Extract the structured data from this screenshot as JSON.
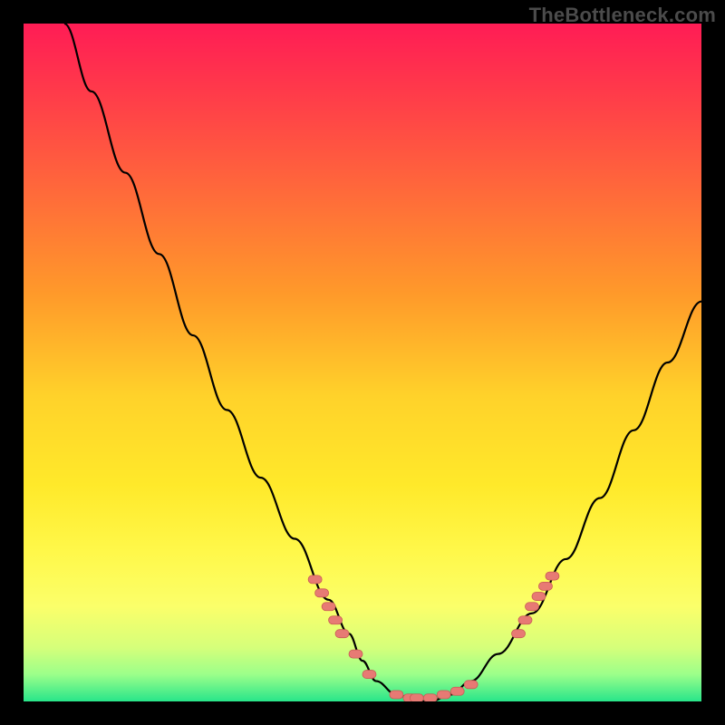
{
  "watermark": {
    "text": "TheBottleneck.com"
  },
  "colors": {
    "curve": "#000000",
    "marker_fill": "#e77a74",
    "marker_stroke": "#c95b55"
  },
  "chart_data": {
    "type": "line",
    "title": "",
    "xlabel": "",
    "ylabel": "",
    "xlim": [
      0,
      100
    ],
    "ylim": [
      0,
      100
    ],
    "grid": false,
    "legend": false,
    "series": [
      {
        "name": "bottleneck-curve",
        "x": [
          6,
          10,
          15,
          20,
          25,
          30,
          35,
          40,
          45,
          48,
          50,
          52,
          55,
          58,
          60,
          63,
          66,
          70,
          75,
          80,
          85,
          90,
          95,
          100
        ],
        "values": [
          100,
          90,
          78,
          66,
          54,
          43,
          33,
          24,
          15,
          10,
          6,
          3,
          1,
          0,
          0,
          1,
          3,
          7,
          13,
          21,
          30,
          40,
          50,
          59
        ]
      }
    ],
    "markers": [
      {
        "name": "left-cluster",
        "points": [
          {
            "x": 43,
            "y": 18
          },
          {
            "x": 44,
            "y": 16
          },
          {
            "x": 45,
            "y": 14
          },
          {
            "x": 46,
            "y": 12
          },
          {
            "x": 47,
            "y": 10
          },
          {
            "x": 49,
            "y": 7
          },
          {
            "x": 51,
            "y": 4
          }
        ]
      },
      {
        "name": "bottom-cluster",
        "points": [
          {
            "x": 55,
            "y": 1
          },
          {
            "x": 57,
            "y": 0.5
          },
          {
            "x": 58,
            "y": 0.5
          },
          {
            "x": 60,
            "y": 0.5
          },
          {
            "x": 62,
            "y": 1
          },
          {
            "x": 64,
            "y": 1.5
          },
          {
            "x": 66,
            "y": 2.5
          }
        ]
      },
      {
        "name": "right-cluster",
        "points": [
          {
            "x": 73,
            "y": 10
          },
          {
            "x": 74,
            "y": 12
          },
          {
            "x": 75,
            "y": 14
          },
          {
            "x": 76,
            "y": 15.5
          },
          {
            "x": 77,
            "y": 17
          },
          {
            "x": 78,
            "y": 18.5
          }
        ]
      }
    ]
  }
}
